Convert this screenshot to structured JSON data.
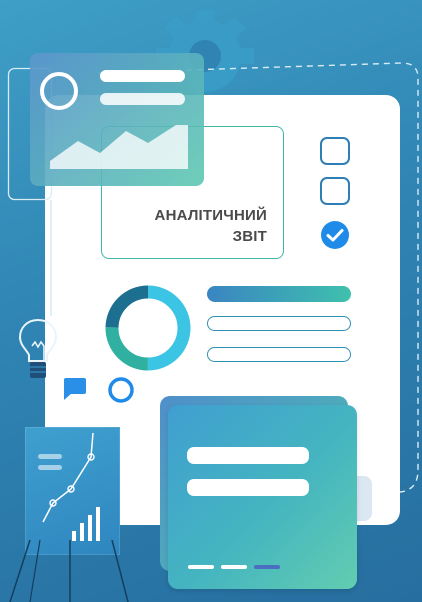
{
  "report": {
    "title_line1": "АНАЛІТИЧНИЙ",
    "title_line2": "ЗВІТ"
  },
  "checklist": [
    {
      "state": "unchecked"
    },
    {
      "state": "unchecked"
    },
    {
      "state": "checked"
    }
  ],
  "donut": {
    "segments": 3
  },
  "progress_bars": [
    {
      "style": "filled"
    },
    {
      "style": "outline"
    },
    {
      "style": "outline"
    }
  ],
  "colors": {
    "background": "#2f84b3",
    "accent_teal": "#3fc0ad",
    "accent_blue": "#2f7fb6",
    "check": "#1f8be8"
  },
  "icons": [
    "gear-icon",
    "lightbulb-icon",
    "chat-bubble-icon",
    "checkmark-icon",
    "flipchart-icon",
    "area-chart-icon"
  ]
}
